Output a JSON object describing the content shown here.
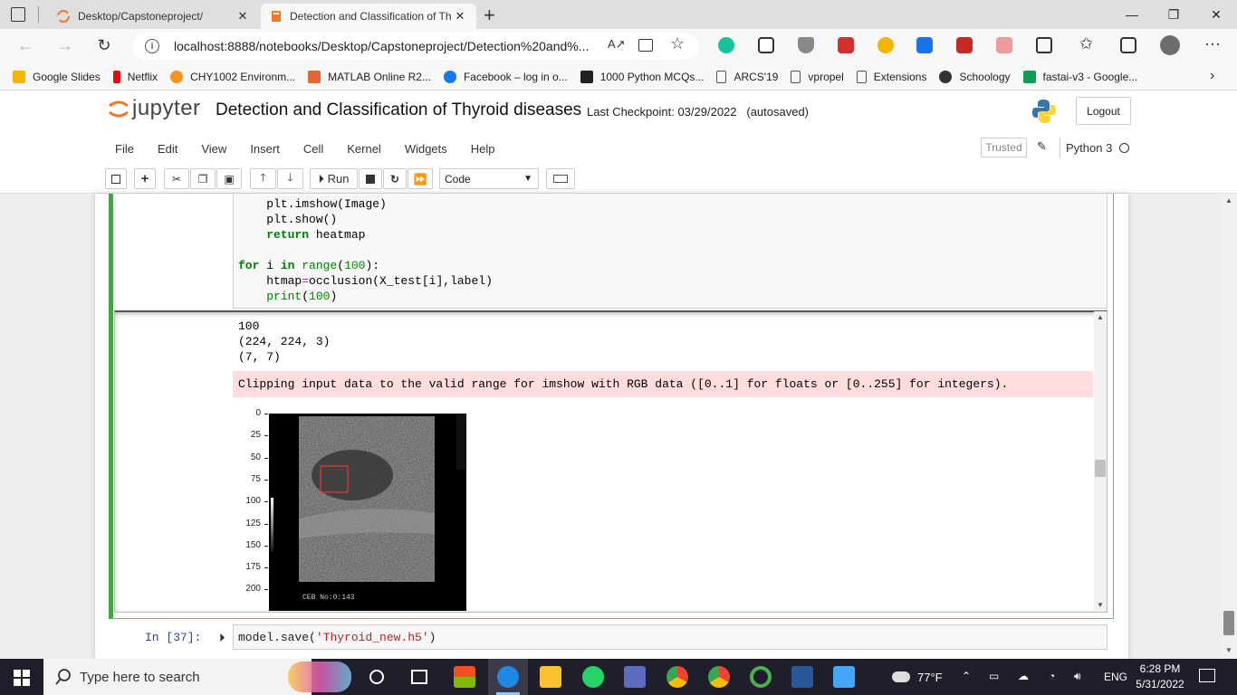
{
  "browser": {
    "tabs": [
      {
        "label": "Desktop/Capstoneproject/",
        "active": false
      },
      {
        "label": "Detection and Classification of Th",
        "active": true
      }
    ],
    "new_tab_symbol": "+",
    "url": "localhost:8888/notebooks/Desktop/Capstoneproject/Detection%20and%...",
    "bookmarks": [
      {
        "label": "Google Slides",
        "color": "#f4b400"
      },
      {
        "label": "Netflix",
        "color": "#e50914"
      },
      {
        "label": "CHY1002 Environm...",
        "color": "#f7941d"
      },
      {
        "label": "MATLAB Online R2...",
        "color": "#e16737"
      },
      {
        "label": "Facebook – log in o...",
        "color": "#1877f2"
      },
      {
        "label": "1000 Python MCQs...",
        "color": "#222222"
      },
      {
        "label": "ARCS'19",
        "color": "#888888"
      },
      {
        "label": "vpropel",
        "color": "#888888"
      },
      {
        "label": "Extensions",
        "color": "#888888"
      },
      {
        "label": "Schoology",
        "color": "#333333"
      },
      {
        "label": "fastai-v3 - Google...",
        "color": "#0f9d58"
      }
    ]
  },
  "jupyter": {
    "logo_text": "jupyter",
    "notebook_title": "Detection and Classification of Thyroid diseases",
    "checkpoint": "Last Checkpoint: 03/29/2022",
    "autosave": "(autosaved)",
    "logout": "Logout",
    "menu": [
      "File",
      "Edit",
      "View",
      "Insert",
      "Cell",
      "Kernel",
      "Widgets",
      "Help"
    ],
    "trusted": "Trusted",
    "kernel": "Python 3",
    "run_label": "Run",
    "cell_type": "Code"
  },
  "cell": {
    "code_lines": [
      {
        "indent": "    ",
        "parts": [
          [
            "plt",
            ""
          ],
          [
            ".",
            ""
          ],
          [
            "imshow",
            ""
          ],
          [
            "(Image)",
            ""
          ]
        ]
      },
      {
        "indent": "    ",
        "parts": [
          [
            "plt.show()",
            ""
          ]
        ]
      },
      {
        "indent": "    ",
        "parts": [
          [
            "return",
            "kw"
          ],
          [
            " heatmap",
            ""
          ]
        ]
      },
      {
        "indent": "",
        "parts": []
      },
      {
        "indent": "",
        "parts": [
          [
            "for",
            "kw"
          ],
          [
            " i ",
            ""
          ],
          [
            "in",
            "kw"
          ],
          [
            " ",
            ""
          ],
          [
            "range",
            "bi"
          ],
          [
            "(",
            ""
          ],
          [
            "100",
            "num"
          ],
          [
            "):",
            ""
          ]
        ]
      },
      {
        "indent": "    ",
        "parts": [
          [
            "htmap",
            ""
          ],
          [
            "=",
            "op"
          ],
          [
            "occlusion(X_test[i],label)",
            ""
          ]
        ]
      },
      {
        "indent": "    ",
        "parts": [
          [
            "print",
            "bi"
          ],
          [
            "(",
            ""
          ],
          [
            "100",
            "num"
          ],
          [
            ")",
            ""
          ]
        ]
      }
    ],
    "output_lines": [
      "100",
      "(224, 224, 3)",
      "(7, 7)"
    ],
    "warning": "Clipping input data to the valid range for imshow with RGB data ([0..1] for floats or [0..255] for integers).",
    "y_ticks": [
      "0",
      "25",
      "50",
      "75",
      "100",
      "125",
      "150",
      "175",
      "200"
    ],
    "image_overlay_text": "CEB     No:0:143"
  },
  "next_cell": {
    "prompt": "In [37]:",
    "code_parts": [
      [
        "model",
        ""
      ],
      [
        ".",
        ""
      ],
      [
        "save(",
        ""
      ],
      [
        "'Thyroid_new.h5'",
        "str"
      ],
      [
        ")",
        ""
      ]
    ]
  },
  "taskbar": {
    "search_placeholder": "Type here to search",
    "weather": "77°F",
    "language": "ENG",
    "time": "6:28 PM",
    "date": "5/31/2022"
  }
}
